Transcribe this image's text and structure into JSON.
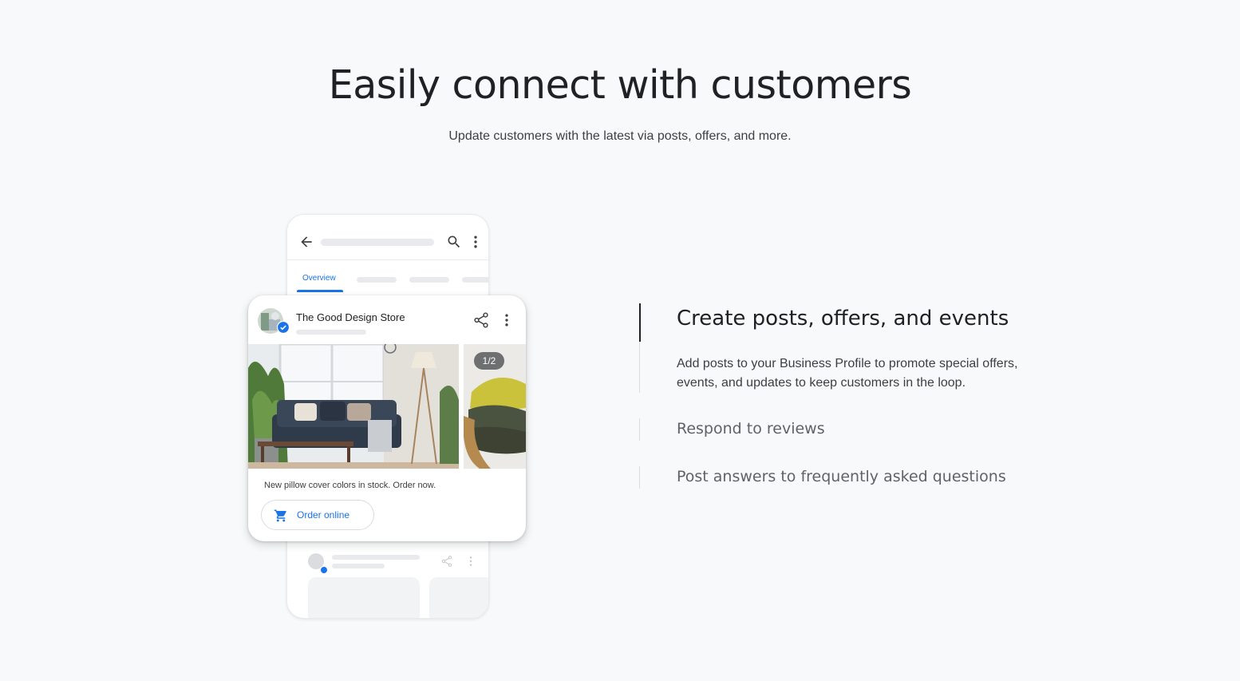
{
  "section": {
    "headline": "Easily connect with customers",
    "subheadline": "Update customers with the latest via posts, offers, and more."
  },
  "phone": {
    "tabs": [
      "Overview"
    ],
    "icons": [
      "arrow-back-icon",
      "search-icon",
      "more-vert-icon",
      "share-icon"
    ]
  },
  "post_card": {
    "store_name": "The Good Design Store",
    "image_counter": "1/2",
    "post_text": "New pillow cover colors in stock. Order now.",
    "cta_label": "Order online",
    "cta_icon": "cart-icon",
    "verified_icon": "verified-badge-icon"
  },
  "features": [
    {
      "title": "Create posts, offers, and events",
      "description": "Add posts to your Business Profile to promote special offers, events, and updates to keep customers in the loop.",
      "active": true
    },
    {
      "title": "Respond to reviews",
      "active": false
    },
    {
      "title": "Post answers to frequently asked questions",
      "active": false
    }
  ],
  "colors": {
    "background": "#f8f9fa",
    "accent": "#1a73e8",
    "text_primary": "#202124",
    "text_secondary": "#5f6368"
  }
}
